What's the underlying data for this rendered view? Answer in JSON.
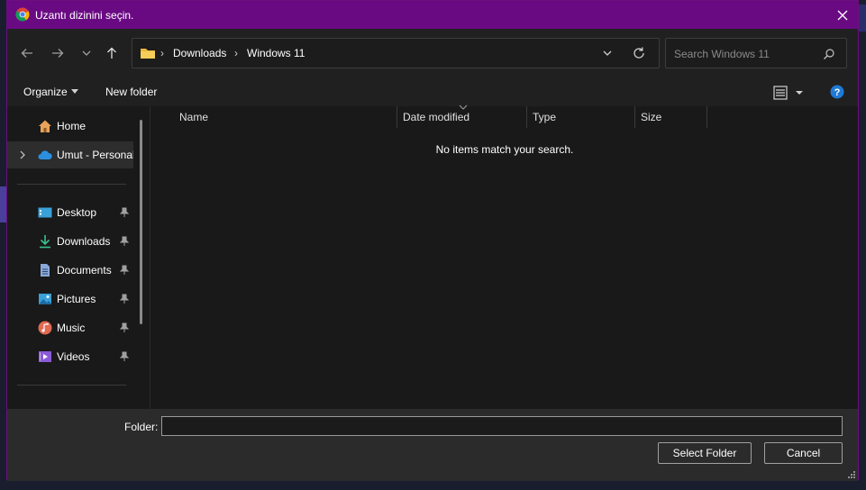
{
  "titlebar": {
    "title": "Uzantı dizinini seçin.",
    "app_icon": "chrome-icon",
    "close_icon": "close-icon",
    "accent": "#6a0a83"
  },
  "navbar": {
    "back_icon": "arrow-left-icon",
    "forward_icon": "arrow-right-icon",
    "recent_icon": "chevron-down-icon",
    "up_icon": "arrow-up-icon",
    "breadcrumb": [
      "Downloads",
      "Windows 11"
    ],
    "search_placeholder": "Search Windows 11"
  },
  "command_bar": {
    "organize_label": "Organize",
    "new_folder_label": "New folder"
  },
  "nav_pane": {
    "top_items": [
      {
        "label": "Home",
        "icon": "home-icon"
      },
      {
        "label": "Umut - Personal",
        "icon": "onedrive-cloud-icon",
        "selected": true
      }
    ],
    "quick_access": [
      {
        "label": "Desktop",
        "icon": "desktop-icon",
        "pinned": true
      },
      {
        "label": "Downloads",
        "icon": "download-icon",
        "pinned": true
      },
      {
        "label": "Documents",
        "icon": "document-icon",
        "pinned": true
      },
      {
        "label": "Pictures",
        "icon": "pictures-icon",
        "pinned": true
      },
      {
        "label": "Music",
        "icon": "music-icon",
        "pinned": true
      },
      {
        "label": "Videos",
        "icon": "video-icon",
        "pinned": true
      }
    ]
  },
  "file_pane": {
    "columns": [
      "Name",
      "Date modified",
      "Type",
      "Size"
    ],
    "empty_message": "No items match your search."
  },
  "footer": {
    "folder_label": "Folder:",
    "folder_value": "",
    "select_label": "Select Folder",
    "cancel_label": "Cancel"
  }
}
